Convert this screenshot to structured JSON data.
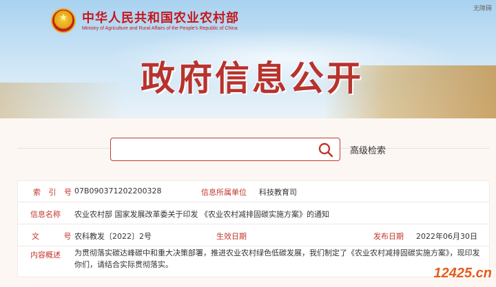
{
  "header": {
    "ministry_cn": "中华人民共和国农业农村部",
    "ministry_en": "Ministry of Agriculture and Rural Affairs of the People's Republic of China",
    "access_link": "无障碍",
    "banner_title": "政府信息公开"
  },
  "search": {
    "value": "",
    "placeholder": "",
    "advanced_label": "高级检索"
  },
  "info": {
    "index_label": "索 引 号",
    "index_value": "07B090371202200328",
    "owner_label": "信息所属单位",
    "owner_value": "科技教育司",
    "name_label": "信息名称",
    "name_value": "农业农村部 国家发展改革委关于印发 《农业农村减排固碳实施方案》的通知",
    "doc_no_label": "文 号",
    "doc_no_value": "农科教发〔2022〕2号",
    "effective_label": "生效日期",
    "effective_value": "",
    "publish_label": "发布日期",
    "publish_value": "2022年06月30日",
    "summary_label": "内容概述",
    "summary_value": "为贯彻落实碳达峰碳中和重大决策部署，推进农业农村绿色低碳发展，我们制定了《农业农村减排固碳实施方案》，现印发你们，请结合实际贯彻落实。"
  },
  "watermark": "12425.cn",
  "colors": {
    "brand_red": "#c5161d",
    "label_red": "#c3342a",
    "search_border": "#bf3a2c",
    "watermark_orange": "#e65b1c"
  },
  "icons": {
    "search": "search-icon",
    "emblem": "national-emblem-icon"
  }
}
